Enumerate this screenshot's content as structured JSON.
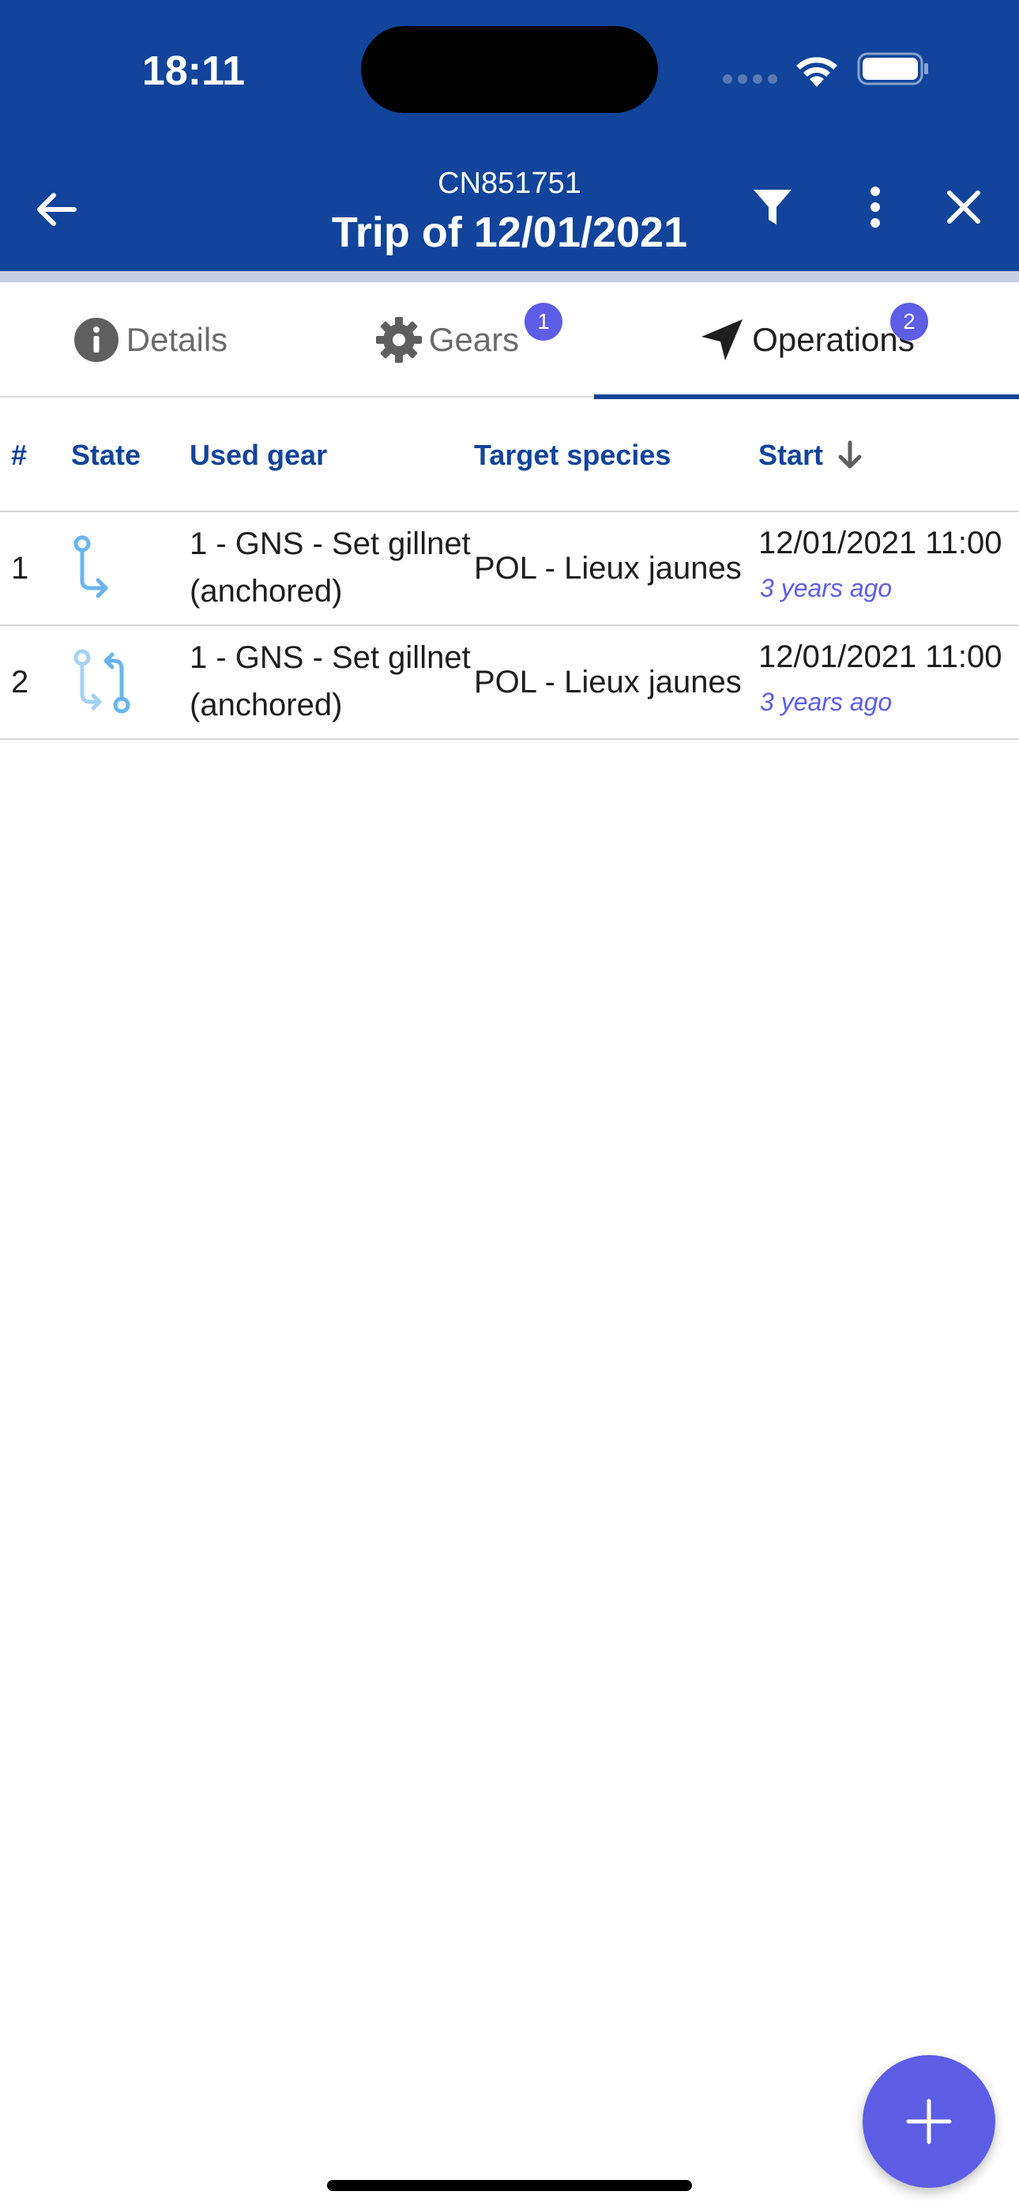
{
  "status_bar": {
    "time": "18:11"
  },
  "header": {
    "subtitle": "CN851751",
    "title": "Trip of 12/01/2021",
    "icons": {
      "back": "arrow-left-icon",
      "filter": "filter-icon",
      "more": "more-vert-icon",
      "close": "close-icon"
    }
  },
  "tabs": [
    {
      "label": "Details",
      "icon": "info-icon",
      "badge": ""
    },
    {
      "label": "Gears",
      "icon": "gear-icon",
      "badge": "1"
    },
    {
      "label": "Operations",
      "icon": "navigation-icon",
      "badge": "2",
      "active": true
    }
  ],
  "table": {
    "columns": [
      "#",
      "State",
      "Used gear",
      "Target species",
      "Start"
    ],
    "sort": {
      "column": "Start",
      "direction": "descending"
    },
    "rows": [
      {
        "num": "1",
        "state_icon": "route-icon",
        "gear": "1 - GNS - Set gillnet (anchored)",
        "species": "POL - Lieux jaunes",
        "start": "12/01/2021 11:00",
        "ago": "3 years ago"
      },
      {
        "num": "2",
        "state_icon": "route-loop-icon",
        "gear": "1 - GNS - Set gillnet (anchored)",
        "species": "POL - Lieux jaunes",
        "start": "12/01/2021 11:00",
        "ago": "3 years ago"
      }
    ]
  },
  "fab": {
    "icon": "add-icon"
  },
  "colors": {
    "header": "#11449a",
    "accent": "#5d5de6",
    "column_header": "#11449a",
    "state_icon": "#6ab4ee"
  }
}
